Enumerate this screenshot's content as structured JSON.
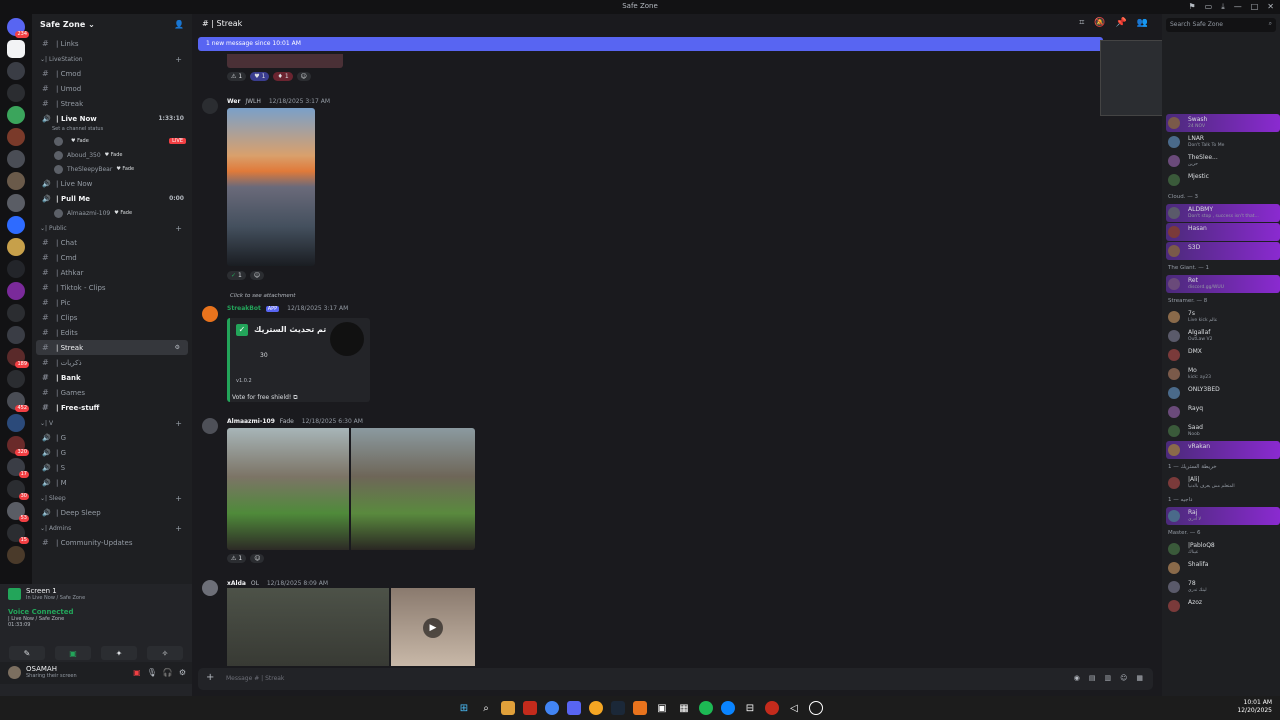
{
  "window": {
    "title": "Safe Zone"
  },
  "server": {
    "name": "Safe Zone"
  },
  "guild_badges": [
    "234",
    "189",
    "452",
    "320",
    "17",
    "30",
    "53",
    "15"
  ],
  "channels": [
    {
      "type": "text",
      "name": "| Links"
    },
    {
      "type": "cat",
      "name": "| LiveStation"
    },
    {
      "type": "text",
      "name": "| Cmod"
    },
    {
      "type": "text",
      "name": "| Umod"
    },
    {
      "type": "text",
      "name": "| Streak"
    },
    {
      "type": "voice",
      "name": "| Live Now",
      "right": "1:33:10",
      "bold": true
    },
    {
      "type": "sub",
      "name": "Set a channel status"
    },
    {
      "type": "vuser",
      "name": "",
      "tag": "Fade",
      "live": "LIVE"
    },
    {
      "type": "vuser",
      "name": "Aboud_350",
      "tag": "Fade"
    },
    {
      "type": "vuser",
      "name": "TheSleepyBear",
      "tag": "Fade"
    },
    {
      "type": "voice",
      "name": "| Live Now"
    },
    {
      "type": "voice",
      "name": "| Pull Me",
      "right": "0:00",
      "bold": true
    },
    {
      "type": "vuser",
      "name": "Almaazmi-109",
      "tag": "Fade"
    },
    {
      "type": "cat",
      "name": "| Public"
    },
    {
      "type": "text",
      "name": "| Chat"
    },
    {
      "type": "text",
      "name": "| Cmd"
    },
    {
      "type": "text",
      "name": "| Athkar"
    },
    {
      "type": "text",
      "name": "| Tiktok - Clips"
    },
    {
      "type": "text",
      "name": "| Pic"
    },
    {
      "type": "text",
      "name": "| Clips"
    },
    {
      "type": "text",
      "name": "| Edits"
    },
    {
      "type": "text",
      "name": "| Streak",
      "active": true
    },
    {
      "type": "text",
      "name": "| ذكريات"
    },
    {
      "type": "text",
      "name": "| Bank",
      "bold": true
    },
    {
      "type": "text",
      "name": "| Games"
    },
    {
      "type": "text",
      "name": "| Free-stuff",
      "bold": true
    },
    {
      "type": "cat",
      "name": "| V"
    },
    {
      "type": "voice",
      "name": "| G"
    },
    {
      "type": "voice",
      "name": "| G"
    },
    {
      "type": "voice",
      "name": "| S"
    },
    {
      "type": "voice",
      "name": "| M"
    },
    {
      "type": "cat",
      "name": "| Sleep"
    },
    {
      "type": "voice",
      "name": "| Deep Sleep"
    },
    {
      "type": "cat",
      "name": "| Admins"
    },
    {
      "type": "text",
      "name": "| Community-Updates"
    }
  ],
  "voice_panel": {
    "screen_label": "Screen 1",
    "screen_sub": "In Live Now / Safe Zone",
    "connected": "Voice Connected",
    "location": "| Live Now / Safe Zone",
    "timer": "01:33:09"
  },
  "user": {
    "name": "OSAMAH",
    "status": "Sharing their screen"
  },
  "chat": {
    "channel": "| Streak",
    "new_messages": "1 new message since 10:01 AM",
    "input_placeholder": "Message # | Streak",
    "messages": [
      {
        "user": "Wer",
        "tag": "JWLH",
        "time": "12/18/2025 3:17 AM"
      },
      {
        "user": "StreakBot",
        "tag": "APP",
        "time": "12/18/2025 3:17 AM",
        "reply": "Click to see attachment"
      },
      {
        "user": "Almaazmi-109",
        "tag": "Fade",
        "time": "12/18/2025 6:30 AM"
      },
      {
        "user": "xAlda",
        "tag": "OL",
        "time": "12/18/2025 8:09 AM"
      }
    ],
    "embed_title": "تم تحديث الستريك",
    "embed_count": "30",
    "embed_version": "v1.0.2",
    "vote_text": "Vote for free shield!",
    "reaction_counts": [
      "1",
      "1",
      "1",
      "1",
      "1",
      "1"
    ]
  },
  "members": {
    "search_placeholder": "Search Safe Zone",
    "list": [
      {
        "kind": "member",
        "name": "Swash",
        "sub": "24 NOV",
        "hl": true
      },
      {
        "kind": "member",
        "name": "LNAR",
        "sub": "Don't Talk To Me"
      },
      {
        "kind": "member",
        "name": "TheSlee...",
        "sub": "حزين"
      },
      {
        "kind": "member",
        "name": "Mjestic"
      },
      {
        "kind": "role",
        "name": "Cloud. — 3"
      },
      {
        "kind": "member",
        "name": "ALDBMY",
        "sub": "Don't stop , success isn't that...",
        "hl": true
      },
      {
        "kind": "member",
        "name": "Hasan",
        "hl": true
      },
      {
        "kind": "member",
        "name": "S3D",
        "hl": true
      },
      {
        "kind": "role",
        "name": "The Giant. — 1"
      },
      {
        "kind": "member",
        "name": "Ret",
        "sub": "discord.gg/WUU",
        "hl": true
      },
      {
        "kind": "role",
        "name": "Streamer. — 8"
      },
      {
        "kind": "member",
        "name": "7s",
        "sub": "Live kick عالم"
      },
      {
        "kind": "member",
        "name": "Algallaf",
        "sub": "OutLaw V2"
      },
      {
        "kind": "member",
        "name": "DMX"
      },
      {
        "kind": "member",
        "name": "Mo",
        "sub": "kick: ay23"
      },
      {
        "kind": "member",
        "name": "ONLY3BED"
      },
      {
        "kind": "member",
        "name": "Rayq"
      },
      {
        "kind": "member",
        "name": "Saad",
        "sub": "Noob"
      },
      {
        "kind": "member",
        "name": "vRakan",
        "hl": true
      },
      {
        "kind": "role",
        "name": "خريطة الستريك — 1"
      },
      {
        "kind": "member",
        "name": "|Ali|",
        "sub": "المتعلم مش يعرف بالدنيا"
      },
      {
        "kind": "role",
        "name": "1 — داجيه"
      },
      {
        "kind": "member",
        "name": "Raj",
        "sub": "لا أدري",
        "hl": true
      },
      {
        "kind": "role",
        "name": "Master. — 6"
      },
      {
        "kind": "member",
        "name": "|PabloQ8",
        "sub": "عيناك"
      },
      {
        "kind": "member",
        "name": "Shalifa"
      },
      {
        "kind": "member",
        "name": "78",
        "sub": "ليتك تدري"
      },
      {
        "kind": "member",
        "name": "Azoz"
      }
    ]
  },
  "taskbar": {
    "time": "10:01 AM",
    "date": "12/20/2025"
  },
  "colors": {
    "accent": "#5865f2",
    "online": "#23a55a",
    "live": "#f23f43",
    "boost": "#8a2ad0"
  }
}
